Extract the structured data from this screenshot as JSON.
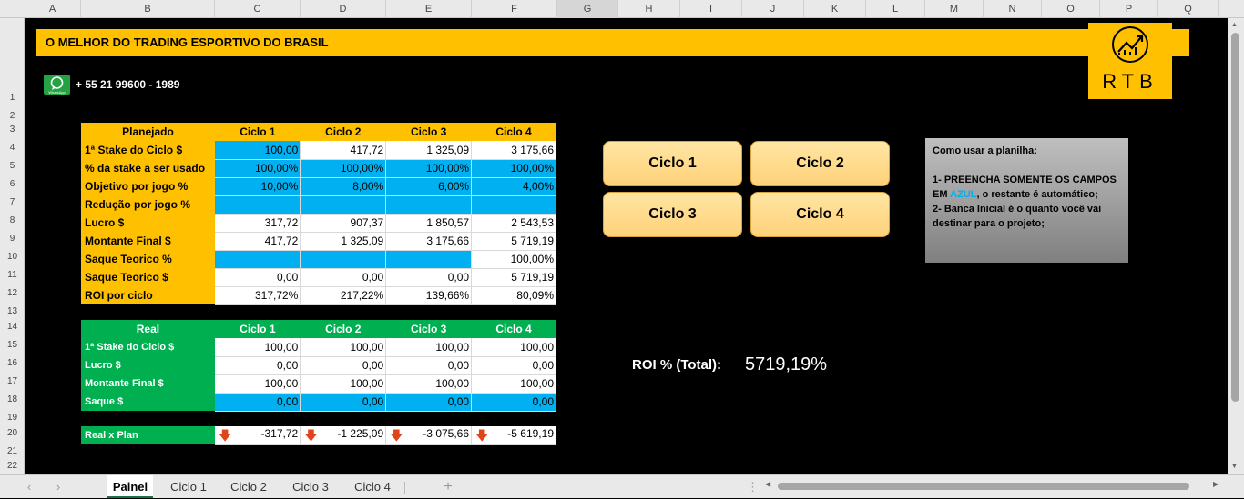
{
  "columns": [
    "A",
    "B",
    "C",
    "D",
    "E",
    "F",
    "G",
    "H",
    "I",
    "J",
    "K",
    "L",
    "M",
    "N",
    "O",
    "P",
    "Q"
  ],
  "rows": [
    "1",
    "2",
    "3",
    "4",
    "5",
    "6",
    "7",
    "8",
    "9",
    "10",
    "11",
    "12",
    "13",
    "14",
    "15",
    "16",
    "17",
    "18",
    "19",
    "20",
    "21",
    "22"
  ],
  "banner": "O MELHOR DO TRADING ESPORTIVO DO BRASIL",
  "phone": "+ 55 21 99600 - 1989",
  "whatsapp_label": "WhatsApp",
  "logo_text": "RTB",
  "planned": {
    "header": [
      "Planejado",
      "Ciclo 1",
      "Ciclo 2",
      "Ciclo 3",
      "Ciclo 4"
    ],
    "rows": [
      {
        "label": "1ª Stake do Ciclo $",
        "cells": [
          "100,00",
          "417,72",
          "1 325,09",
          "3 175,66"
        ]
      },
      {
        "label": "% da stake a ser usado",
        "cells": [
          "100,00%",
          "100,00%",
          "100,00%",
          "100,00%"
        ]
      },
      {
        "label": "Objetivo por jogo %",
        "cells": [
          "10,00%",
          "8,00%",
          "6,00%",
          "4,00%"
        ]
      },
      {
        "label": "Redução por jogo %",
        "cells": [
          "",
          "",
          "",
          ""
        ]
      },
      {
        "label": "Lucro $",
        "cells": [
          "317,72",
          "907,37",
          "1 850,57",
          "2 543,53"
        ]
      },
      {
        "label": "Montante Final $",
        "cells": [
          "417,72",
          "1 325,09",
          "3 175,66",
          "5 719,19"
        ]
      },
      {
        "label": "Saque Teorico %",
        "cells": [
          "",
          "",
          "",
          "100,00%"
        ]
      },
      {
        "label": "Saque Teorico $",
        "cells": [
          "0,00",
          "0,00",
          "0,00",
          "5 719,19"
        ]
      },
      {
        "label": "ROI por ciclo",
        "cells": [
          "317,72%",
          "217,22%",
          "139,66%",
          "80,09%"
        ]
      }
    ]
  },
  "real": {
    "header": [
      "Real",
      "Ciclo 1",
      "Ciclo 2",
      "Ciclo 3",
      "Ciclo 4"
    ],
    "rows": [
      {
        "label": "1ª Stake do Ciclo $",
        "cells": [
          "100,00",
          "100,00",
          "100,00",
          "100,00"
        ]
      },
      {
        "label": "Lucro $",
        "cells": [
          "0,00",
          "0,00",
          "0,00",
          "0,00"
        ]
      },
      {
        "label": "Montante Final $",
        "cells": [
          "100,00",
          "100,00",
          "100,00",
          "100,00"
        ]
      },
      {
        "label": "Saque $",
        "cells": [
          "0,00",
          "0,00",
          "0,00",
          "0,00"
        ]
      }
    ]
  },
  "real_vs_plan": {
    "label": "Real x Plan",
    "cells": [
      "-317,72",
      "-1 225,09",
      "-3 075,66",
      "-5 619,19"
    ]
  },
  "buttons": [
    "Ciclo 1",
    "Ciclo 2",
    "Ciclo 3",
    "Ciclo 4"
  ],
  "help": {
    "title": "Como usar a planilha:",
    "line1a": "1- PREENCHA SOMENTE OS CAMPOS EM ",
    "line1_azul": "AZUL",
    "line1b": ", o restante é automático;",
    "line2": "2- Banca Inicial é o quanto você vai destinar para o projeto;"
  },
  "roi": {
    "label": "ROI % (Total):",
    "value": "5719,19%"
  },
  "sheets": [
    "Painel",
    "Ciclo 1",
    "Ciclo 2",
    "Ciclo 3",
    "Ciclo 4"
  ],
  "add_sheet": "+",
  "colors": {
    "yellow": "#ffc000",
    "blue": "#00b0f0",
    "green": "#00b050"
  }
}
